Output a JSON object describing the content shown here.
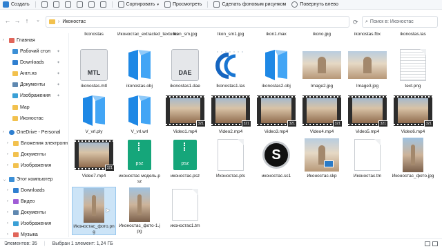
{
  "toolbar": {
    "create": "Создать",
    "sort": "Сортировать",
    "view": "Просмотреть",
    "set_background": "Сделать фоновым рисунком",
    "rotate_left": "Повернуть влево"
  },
  "address": {
    "path": "Иконостас",
    "search_placeholder": "Поиск в: Иконостас"
  },
  "sidebar": {
    "items": [
      {
        "label": "Главная",
        "color": "#e0655a"
      },
      {
        "label": "Рабочий стол",
        "color": "#3b8fd6"
      },
      {
        "label": "Downloads",
        "color": "#2f7fd0"
      },
      {
        "label": "Англ.яз",
        "color": "#f2c14e"
      },
      {
        "label": "Документы",
        "color": "#5f88b0"
      },
      {
        "label": "Изображения",
        "color": "#3ba0d6"
      },
      {
        "label": "Мар",
        "color": "#f2c14e"
      },
      {
        "label": "Иконостас",
        "color": "#f2c14e"
      },
      {
        "label": "OneDrive - Personal",
        "color": "#2f7fd0"
      },
      {
        "label": "Вложения электронн",
        "color": "#f2c14e"
      },
      {
        "label": "Документы",
        "color": "#f2c14e"
      },
      {
        "label": "Изображения",
        "color": "#f2c14e"
      },
      {
        "label": "Этот компьютер",
        "color": "#3b8fd6"
      },
      {
        "label": "Downloads",
        "color": "#2f7fd0"
      },
      {
        "label": "Видео",
        "color": "#a05cd6"
      },
      {
        "label": "Документы",
        "color": "#5f88b0"
      },
      {
        "label": "Изображения",
        "color": "#3ba0d6"
      },
      {
        "label": "Музыка",
        "color": "#e0655a"
      }
    ]
  },
  "top_partial_row": [
    "Ikonostas",
    "Иконостас_extracted_textures",
    "Ikon_sm.jpg",
    "Ikon_sm1.jpg",
    "ikon1.max",
    "ikono.jpg",
    "ikonostas.fbx",
    "ikonostas.las"
  ],
  "files": {
    "r1": [
      "ikonostas.mtl",
      "ikonostas.obj",
      "ikonostas1.dae",
      "Ikonostas1.las",
      "ikonostas2.obj",
      "Image2.jpg",
      "Image3.jpg",
      "text.png"
    ],
    "r2": [
      "V_vrl.ply",
      "V_vrl.wrl",
      "Video1.mp4",
      "Video2.mp4",
      "Video3.mp4",
      "Video4.mp4",
      "Video5.mp4",
      "Video6.mp4"
    ],
    "r3": [
      "Video7.mp4",
      "иконостас модель.psz",
      "иконостас.psz",
      "Иконостас.pts",
      "иконостас.sc1",
      "Иконостас.skp",
      "Иконостас.tm",
      "Иконостас_фото.jpg"
    ],
    "r4": [
      "Иконостас_фото.png",
      "Иконостас_фото-1.jpg",
      "иконостас1.tm"
    ]
  },
  "labels": {
    "mtl": "MTL",
    "dae": "DAE",
    "psz": "psz",
    "video_badge": "321"
  },
  "status": {
    "count": "Элементов: 35",
    "selection": "Выбран 1 элемент: 1,24 ГБ"
  }
}
